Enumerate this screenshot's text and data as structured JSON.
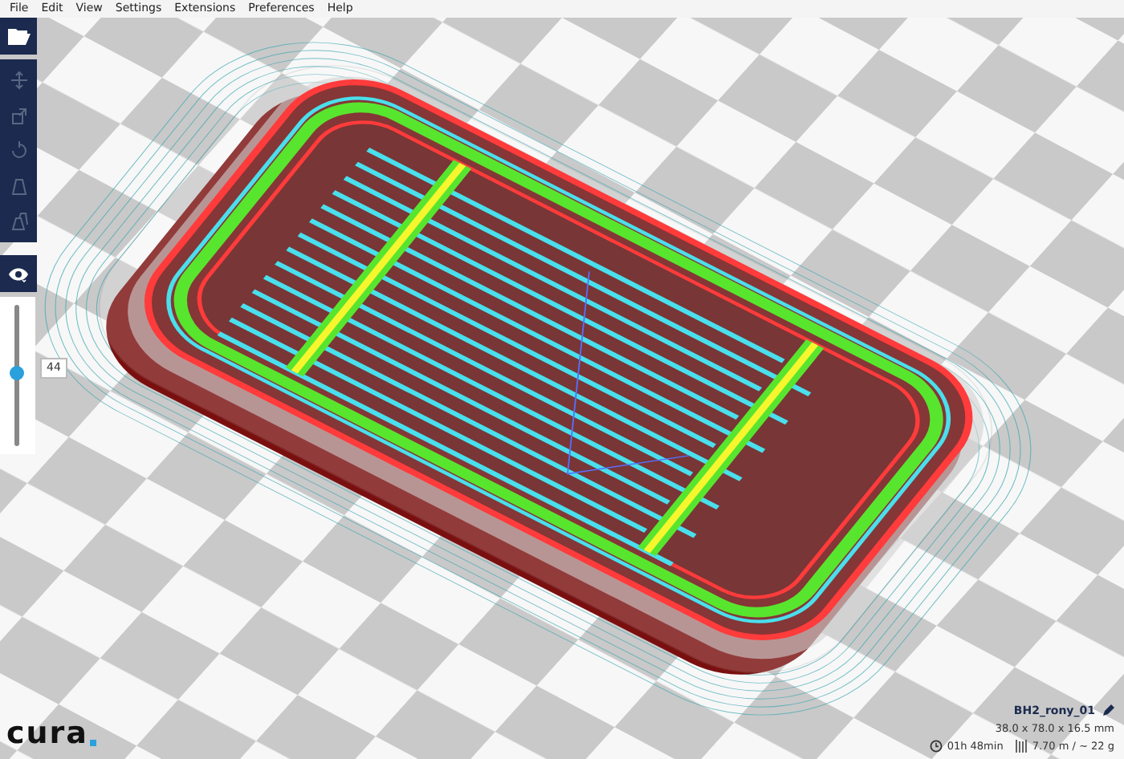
{
  "menu": [
    "File",
    "Edit",
    "View",
    "Settings",
    "Extensions",
    "Preferences",
    "Help"
  ],
  "toolbar": {
    "tools": [
      {
        "kind": "move",
        "disabled": true
      },
      {
        "kind": "scale",
        "disabled": true
      },
      {
        "kind": "rotate",
        "disabled": true
      },
      {
        "kind": "mirror",
        "disabled": true
      },
      {
        "kind": "per-model",
        "disabled": true
      }
    ]
  },
  "layer_slider": {
    "value": "44",
    "level": 0.52
  },
  "job": {
    "name": "BH2_rony_01",
    "dimensions": "38.0 x 78.0 x 16.5 mm",
    "print_time": "01h 48min",
    "material": "7.70 m / ~ 22 g"
  },
  "logo": "cura"
}
